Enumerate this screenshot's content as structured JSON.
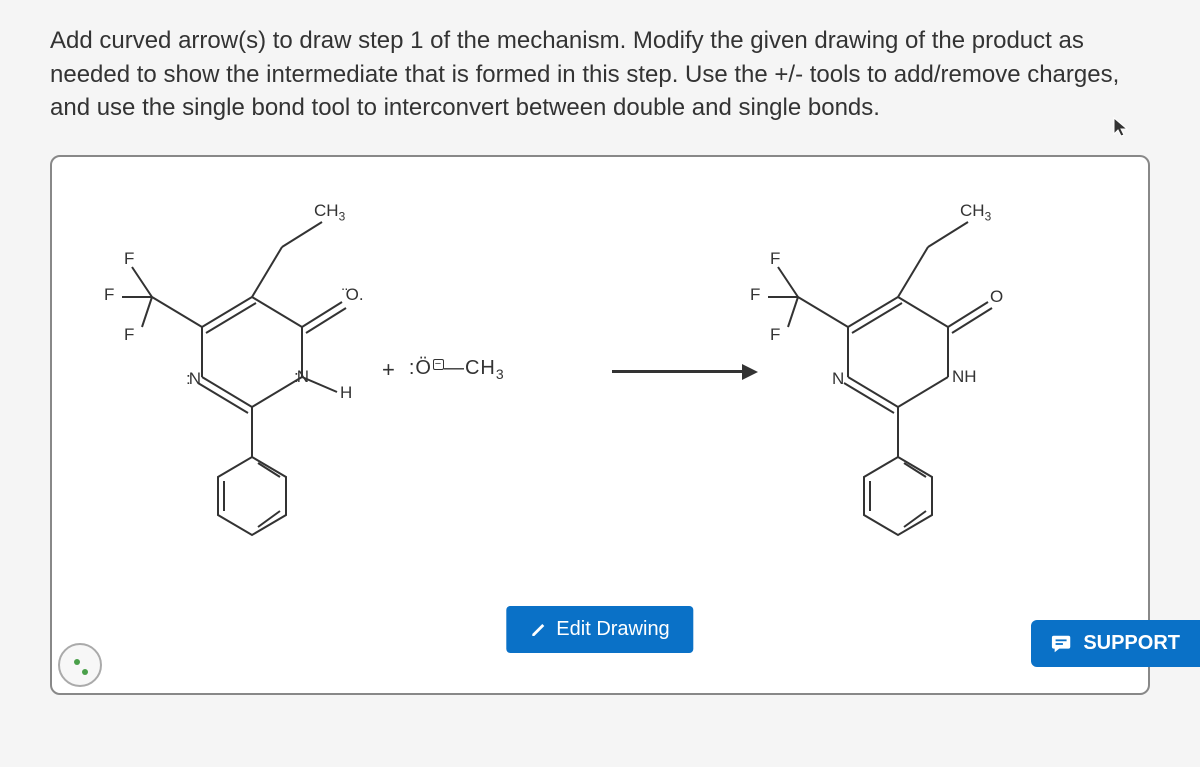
{
  "instructions": "Add curved arrow(s) to draw step 1 of the mechanism. Modify the given drawing of the product as needed to show the intermediate that is formed in this step. Use the +/- tools to add/remove charges, and use the single bond tool to interconvert between double and single bonds.",
  "reagent": {
    "plus": "+",
    "formula_prefix": ":Ö",
    "formula_bond": "—",
    "formula_suffix": "CH",
    "formula_sub": "3"
  },
  "buttons": {
    "edit_drawing": "Edit Drawing",
    "support": "SUPPORT"
  },
  "molecule_left": {
    "ch3": "CH",
    "ch3_sub": "3",
    "f1": "F",
    "f2": "F",
    "f3": "F",
    "n1": "N",
    "n2": "N",
    "h": "H",
    "o": "O"
  },
  "molecule_right": {
    "ch3": "CH",
    "ch3_sub": "3",
    "f1": "F",
    "f2": "F",
    "f3": "F",
    "n1": "N",
    "nh": "NH",
    "o": "O"
  }
}
